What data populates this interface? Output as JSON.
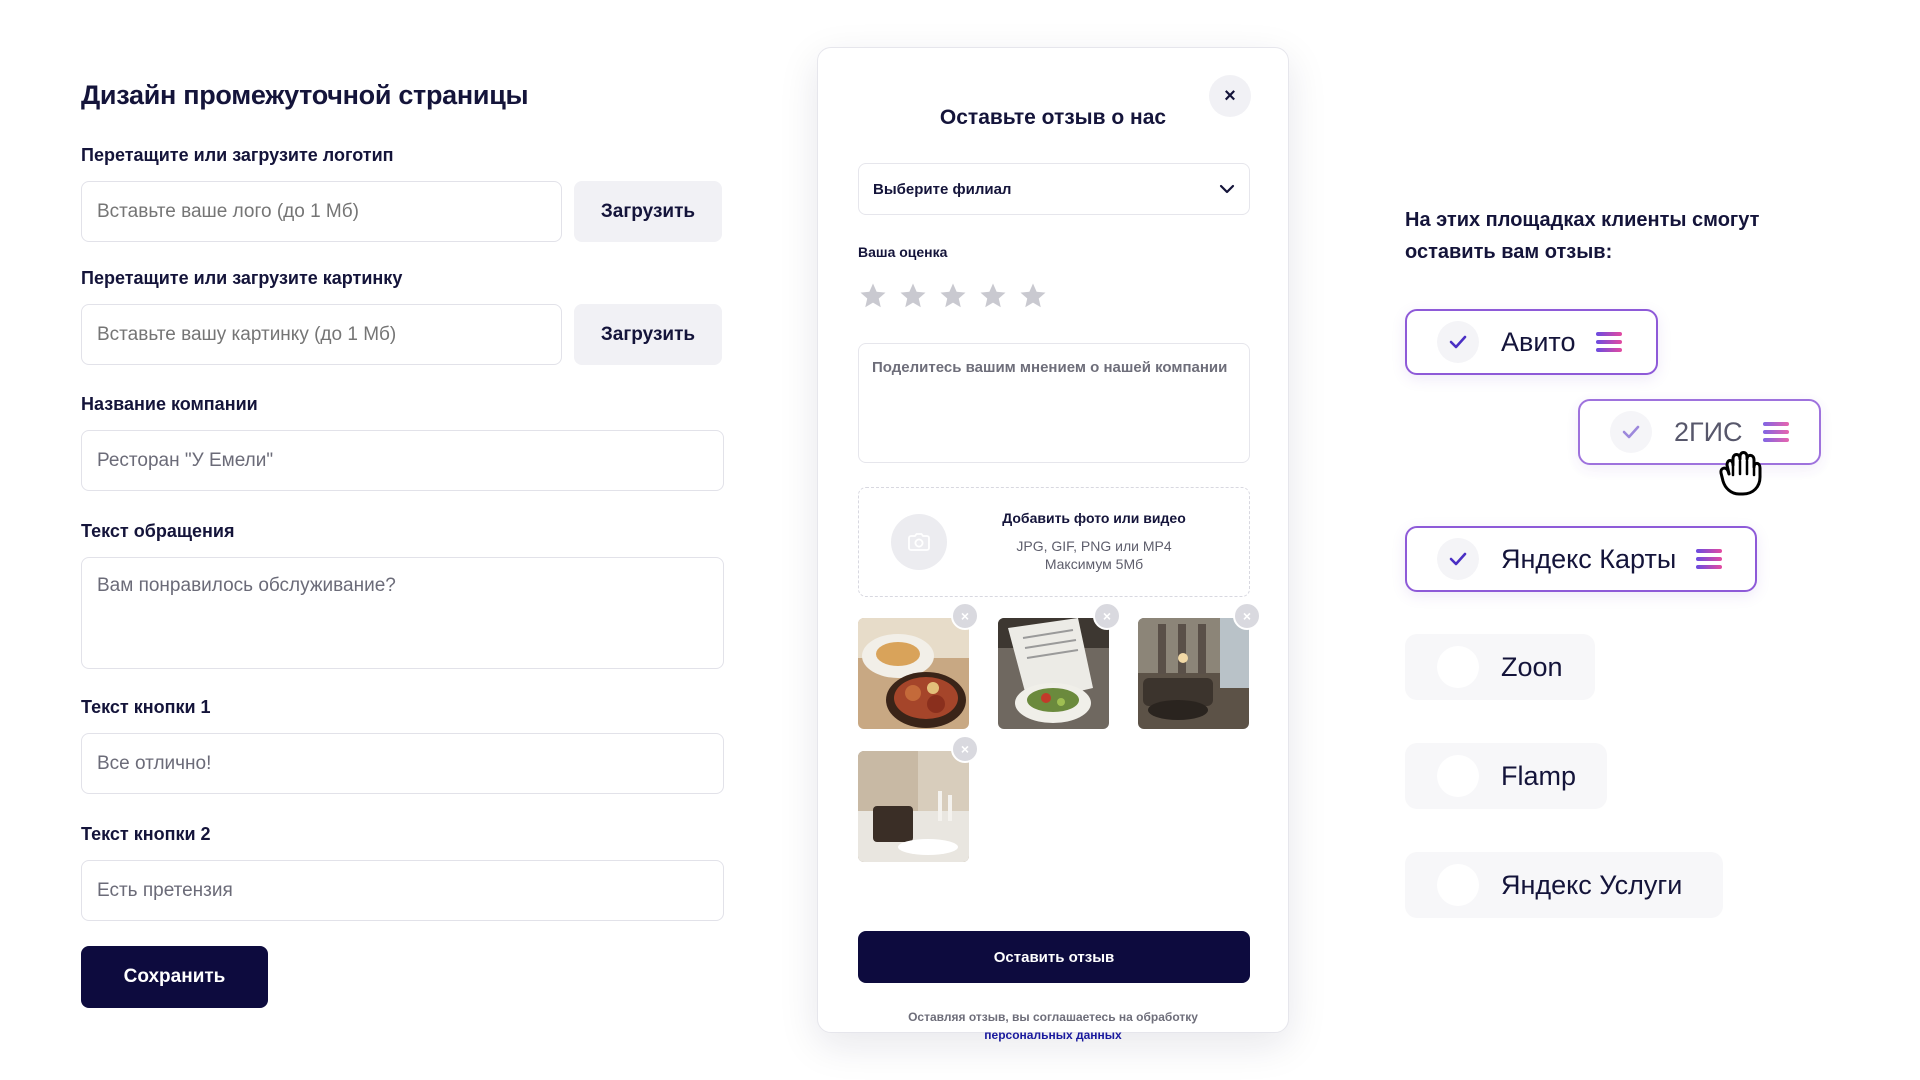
{
  "settings": {
    "title": "Дизайн промежуточной страницы",
    "logo_label": "Перетащите или загрузите логотип",
    "logo_placeholder": "Вставьте ваше лого (до 1 Мб)",
    "upload_label": "Загрузить",
    "image_label": "Перетащите или загрузите картинку",
    "image_placeholder": "Вставьте вашу картинку (до 1 Мб)",
    "company_label": "Название компании",
    "company_value": "Ресторан \"У Емели\"",
    "appeal_label": "Текст обращения",
    "appeal_value": "Вам понравилось обслуживание?",
    "button1_label": "Текст кнопки 1",
    "button1_value": "Все отлично!",
    "button2_label": "Текст кнопки 2",
    "button2_value": "Есть претензия",
    "save_label": "Сохранить"
  },
  "modal": {
    "title": "Оставьте отзыв о нас",
    "close_symbol": "×",
    "branch_select": "Выберите филиал",
    "rating_label": "Ваша оценка",
    "stars_total": 5,
    "stars_selected": 0,
    "review_placeholder": "Поделитесь вашим мнением о нашей компании",
    "dropzone_title": "Добавить фото или видео",
    "dropzone_formats": "JPG, GIF, PNG или MP4",
    "dropzone_max": "Максимум 5Мб",
    "thumb_remove_symbol": "×",
    "submit_label": "Оставить отзыв",
    "consent_text": "Оставляя отзыв, вы соглашаетесь на обработку",
    "consent_link": "персональных данных"
  },
  "platforms": {
    "heading": "На этих площадках клиенты смогут оставить вам отзыв:",
    "items": [
      {
        "name": "Авито",
        "checked": true
      },
      {
        "name": "2ГИС",
        "checked": true
      },
      {
        "name": "Яндекс Карты",
        "checked": true
      },
      {
        "name": "Zoon",
        "checked": false
      },
      {
        "name": "Flamp",
        "checked": false
      },
      {
        "name": "Яндекс Услуги",
        "checked": false
      }
    ]
  },
  "colors": {
    "primary": "#0d0b3e",
    "accent_border": "#8e5ad8",
    "handle_gradient_start": "#6a4be0",
    "handle_gradient_end": "#e44aa0",
    "check": "#4a2fc4"
  }
}
